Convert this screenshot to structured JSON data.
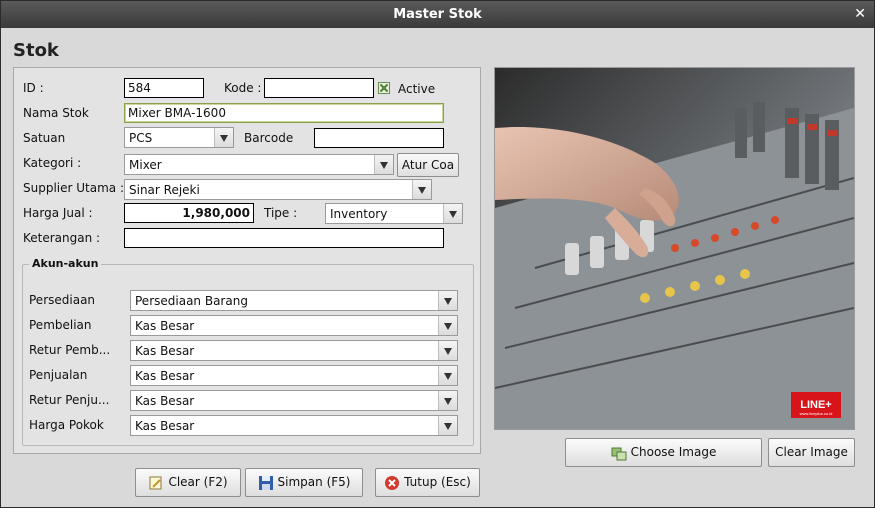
{
  "window": {
    "title": "Master Stok",
    "close_glyph": "✕"
  },
  "heading": "Stok",
  "form": {
    "id_label": "ID :",
    "id_value": "584",
    "kode_label": "Kode :",
    "kode_value": "",
    "active_label": "Active",
    "active_checked": true,
    "nama_label": "Nama Stok",
    "nama_value": "Mixer BMA-1600",
    "satuan_label": "Satuan",
    "satuan_value": "PCS",
    "barcode_label": "Barcode",
    "barcode_value": "",
    "kategori_label": "Kategori :",
    "kategori_value": "Mixer",
    "atur_coa_label": "Atur Coa",
    "supplier_label": "Supplier Utama :",
    "supplier_value": "Sinar Rejeki",
    "harga_label": "Harga Jual :",
    "harga_value": "1,980,000",
    "tipe_label": "Tipe :",
    "tipe_value": "Inventory",
    "keterangan_label": "Keterangan :",
    "keterangan_value": ""
  },
  "akun": {
    "title": "Akun-akun",
    "rows": [
      {
        "label": "Persediaan",
        "value": "Persediaan Barang"
      },
      {
        "label": "Pembelian",
        "value": "Kas Besar"
      },
      {
        "label": "Retur Pemb...",
        "value": "Kas Besar"
      },
      {
        "label": "Penjualan",
        "value": "Kas Besar"
      },
      {
        "label": "Retur Penju...",
        "value": "Kas Besar"
      },
      {
        "label": "Harga Pokok",
        "value": "Kas Besar"
      }
    ]
  },
  "image": {
    "logo_text": "LINE+",
    "logo_subtext": "www.lineplus.co.id"
  },
  "buttons": {
    "choose_image": "Choose Image",
    "clear_image": "Clear Image",
    "clear": "Clear (F2)",
    "simpan": "Simpan (F5)",
    "tutup": "Tutup (Esc)"
  },
  "colors": {
    "titlebar": "#3f3f3f",
    "background": "#d9d9d9",
    "focus_border": "#8aa04a",
    "logo_red": "#d8141b"
  }
}
